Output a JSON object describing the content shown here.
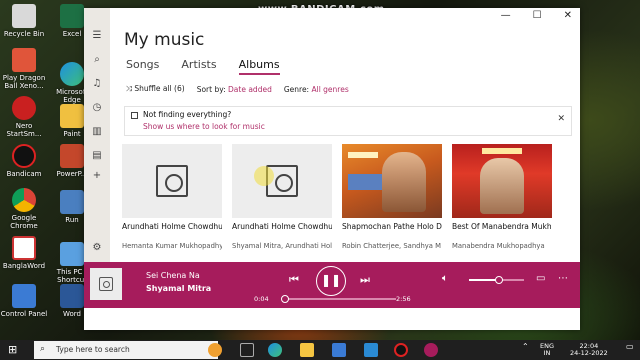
{
  "watermark": "www.BANDICAM.com",
  "desktop_icons": [
    {
      "label": "Recycle Bin"
    },
    {
      "label": "Play Dragon Ball Xeno..."
    },
    {
      "label": "Nero StartSm..."
    },
    {
      "label": "Bandicam"
    },
    {
      "label": "Google Chrome"
    },
    {
      "label": "BanglaWord"
    },
    {
      "label": "Control Panel"
    },
    {
      "label": "Excel"
    },
    {
      "label": "Microsoft Edge"
    },
    {
      "label": "Paint"
    },
    {
      "label": "PowerP..."
    },
    {
      "label": "Run"
    },
    {
      "label": "This PC - Shortcut"
    },
    {
      "label": "Word"
    }
  ],
  "window": {
    "controls": {
      "minimize": "—",
      "maximize": "☐",
      "close": "✕"
    },
    "title": "My music",
    "tabs": [
      {
        "label": "Songs",
        "active": false
      },
      {
        "label": "Artists",
        "active": false
      },
      {
        "label": "Albums",
        "active": true
      }
    ],
    "toolbar": {
      "shuffle_label": "Shuffle all (6)",
      "sort_label": "Sort by:",
      "sort_value": "Date added",
      "genre_label": "Genre:",
      "genre_value": "All genres"
    },
    "notice": {
      "title": "Not finding everything?",
      "link": "Show us where to look for music"
    },
    "albums": [
      {
        "name": "Arundhati Holme Chowdhury - Jete Jete Ki",
        "artist": "Hemanta Kumar Mukhopadhyay",
        "art": "placeholder"
      },
      {
        "name": "Arundhati Holme Chowdhury - Jete Jete Ki",
        "artist": "Shyamal Mitra, Arundhati Holme",
        "art": "placeholder"
      },
      {
        "name": "Shapmochan Pathe Holo Deri Indrani",
        "artist": "Robin Chatterjee, Sandhya M",
        "art": "cover-orange"
      },
      {
        "name": "Best Of Manabendra Mukherjee",
        "artist": "Manabendra Mukhopadhya",
        "art": "cover-red"
      }
    ]
  },
  "player": {
    "track": "Sei Chena Na",
    "artist": "Shyamal Mitra",
    "time_elapsed": "0:04",
    "time_total": "2:56",
    "progress_fraction": 0.03,
    "volume_fraction": 0.55
  },
  "taskbar": {
    "search_placeholder": "Type here to search",
    "lang_top": "ENG",
    "lang_bottom": "IN",
    "time": "22:04",
    "date": "24-12-2022"
  },
  "colors": {
    "accent": "#b0306a",
    "player_bg": "#a61c5c"
  }
}
